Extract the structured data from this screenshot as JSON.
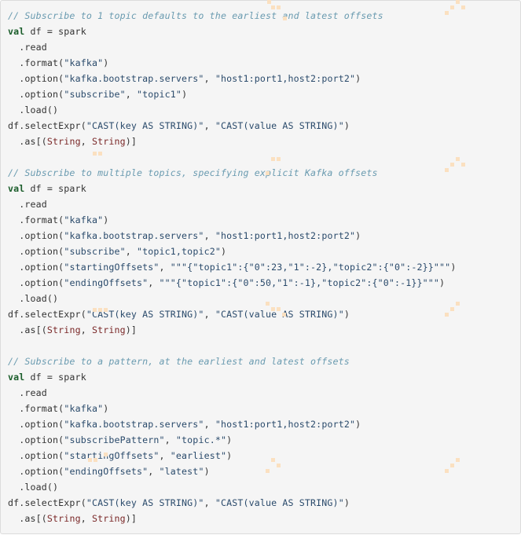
{
  "code_block": {
    "language": "scala",
    "lines": [
      [
        {
          "t": "comment",
          "v": "// Subscribe to 1 topic defaults to the earliest and latest offsets"
        }
      ],
      [
        {
          "t": "kw",
          "v": "val"
        },
        {
          "t": "plain",
          "v": " df = spark"
        }
      ],
      [
        {
          "t": "plain",
          "v": "  .read"
        }
      ],
      [
        {
          "t": "plain",
          "v": "  .format("
        },
        {
          "t": "str",
          "v": "\"kafka\""
        },
        {
          "t": "plain",
          "v": ")"
        }
      ],
      [
        {
          "t": "plain",
          "v": "  .option("
        },
        {
          "t": "str",
          "v": "\"kafka.bootstrap.servers\""
        },
        {
          "t": "plain",
          "v": ", "
        },
        {
          "t": "str",
          "v": "\"host1:port1,host2:port2\""
        },
        {
          "t": "plain",
          "v": ")"
        }
      ],
      [
        {
          "t": "plain",
          "v": "  .option("
        },
        {
          "t": "str",
          "v": "\"subscribe\""
        },
        {
          "t": "plain",
          "v": ", "
        },
        {
          "t": "str",
          "v": "\"topic1\""
        },
        {
          "t": "plain",
          "v": ")"
        }
      ],
      [
        {
          "t": "plain",
          "v": "  .load()"
        }
      ],
      [
        {
          "t": "plain",
          "v": "df.selectExpr("
        },
        {
          "t": "str",
          "v": "\"CAST(key AS STRING)\""
        },
        {
          "t": "plain",
          "v": ", "
        },
        {
          "t": "str",
          "v": "\"CAST(value AS STRING)\""
        },
        {
          "t": "plain",
          "v": ")"
        }
      ],
      [
        {
          "t": "plain",
          "v": "  .as[("
        },
        {
          "t": "type",
          "v": "String"
        },
        {
          "t": "plain",
          "v": ", "
        },
        {
          "t": "type",
          "v": "String"
        },
        {
          "t": "plain",
          "v": ")]"
        }
      ],
      [],
      [
        {
          "t": "comment",
          "v": "// Subscribe to multiple topics, specifying explicit Kafka offsets"
        }
      ],
      [
        {
          "t": "kw",
          "v": "val"
        },
        {
          "t": "plain",
          "v": " df = spark"
        }
      ],
      [
        {
          "t": "plain",
          "v": "  .read"
        }
      ],
      [
        {
          "t": "plain",
          "v": "  .format("
        },
        {
          "t": "str",
          "v": "\"kafka\""
        },
        {
          "t": "plain",
          "v": ")"
        }
      ],
      [
        {
          "t": "plain",
          "v": "  .option("
        },
        {
          "t": "str",
          "v": "\"kafka.bootstrap.servers\""
        },
        {
          "t": "plain",
          "v": ", "
        },
        {
          "t": "str",
          "v": "\"host1:port1,host2:port2\""
        },
        {
          "t": "plain",
          "v": ")"
        }
      ],
      [
        {
          "t": "plain",
          "v": "  .option("
        },
        {
          "t": "str",
          "v": "\"subscribe\""
        },
        {
          "t": "plain",
          "v": ", "
        },
        {
          "t": "str",
          "v": "\"topic1,topic2\""
        },
        {
          "t": "plain",
          "v": ")"
        }
      ],
      [
        {
          "t": "plain",
          "v": "  .option("
        },
        {
          "t": "str",
          "v": "\"startingOffsets\""
        },
        {
          "t": "plain",
          "v": ", "
        },
        {
          "t": "str",
          "v": "\"\"\"{\"topic1\":{\"0\":23,\"1\":-2},\"topic2\":{\"0\":-2}}\"\"\""
        },
        {
          "t": "plain",
          "v": ")"
        }
      ],
      [
        {
          "t": "plain",
          "v": "  .option("
        },
        {
          "t": "str",
          "v": "\"endingOffsets\""
        },
        {
          "t": "plain",
          "v": ", "
        },
        {
          "t": "str",
          "v": "\"\"\"{\"topic1\":{\"0\":50,\"1\":-1},\"topic2\":{\"0\":-1}}\"\"\""
        },
        {
          "t": "plain",
          "v": ")"
        }
      ],
      [
        {
          "t": "plain",
          "v": "  .load()"
        }
      ],
      [
        {
          "t": "plain",
          "v": "df.selectExpr("
        },
        {
          "t": "str",
          "v": "\"CAST(key AS STRING)\""
        },
        {
          "t": "plain",
          "v": ", "
        },
        {
          "t": "str",
          "v": "\"CAST(value AS STRING)\""
        },
        {
          "t": "plain",
          "v": ")"
        }
      ],
      [
        {
          "t": "plain",
          "v": "  .as[("
        },
        {
          "t": "type",
          "v": "String"
        },
        {
          "t": "plain",
          "v": ", "
        },
        {
          "t": "type",
          "v": "String"
        },
        {
          "t": "plain",
          "v": ")]"
        }
      ],
      [],
      [
        {
          "t": "comment",
          "v": "// Subscribe to a pattern, at the earliest and latest offsets"
        }
      ],
      [
        {
          "t": "kw",
          "v": "val"
        },
        {
          "t": "plain",
          "v": " df = spark"
        }
      ],
      [
        {
          "t": "plain",
          "v": "  .read"
        }
      ],
      [
        {
          "t": "plain",
          "v": "  .format("
        },
        {
          "t": "str",
          "v": "\"kafka\""
        },
        {
          "t": "plain",
          "v": ")"
        }
      ],
      [
        {
          "t": "plain",
          "v": "  .option("
        },
        {
          "t": "str",
          "v": "\"kafka.bootstrap.servers\""
        },
        {
          "t": "plain",
          "v": ", "
        },
        {
          "t": "str",
          "v": "\"host1:port1,host2:port2\""
        },
        {
          "t": "plain",
          "v": ")"
        }
      ],
      [
        {
          "t": "plain",
          "v": "  .option("
        },
        {
          "t": "str",
          "v": "\"subscribePattern\""
        },
        {
          "t": "plain",
          "v": ", "
        },
        {
          "t": "str",
          "v": "\"topic.*\""
        },
        {
          "t": "plain",
          "v": ")"
        }
      ],
      [
        {
          "t": "plain",
          "v": "  .option("
        },
        {
          "t": "str",
          "v": "\"startingOffsets\""
        },
        {
          "t": "plain",
          "v": ", "
        },
        {
          "t": "str",
          "v": "\"earliest\""
        },
        {
          "t": "plain",
          "v": ")"
        }
      ],
      [
        {
          "t": "plain",
          "v": "  .option("
        },
        {
          "t": "str",
          "v": "\"endingOffsets\""
        },
        {
          "t": "plain",
          "v": ", "
        },
        {
          "t": "str",
          "v": "\"latest\""
        },
        {
          "t": "plain",
          "v": ")"
        }
      ],
      [
        {
          "t": "plain",
          "v": "  .load()"
        }
      ],
      [
        {
          "t": "plain",
          "v": "df.selectExpr("
        },
        {
          "t": "str",
          "v": "\"CAST(key AS STRING)\""
        },
        {
          "t": "plain",
          "v": ", "
        },
        {
          "t": "str",
          "v": "\"CAST(value AS STRING)\""
        },
        {
          "t": "plain",
          "v": ")"
        }
      ],
      [
        {
          "t": "plain",
          "v": "  .as[("
        },
        {
          "t": "type",
          "v": "String"
        },
        {
          "t": "plain",
          "v": ", "
        },
        {
          "t": "type",
          "v": "String"
        },
        {
          "t": "plain",
          "v": ")]"
        }
      ]
    ]
  },
  "colors": {
    "background": "#f5f5f5",
    "comment": "#6a9bb0",
    "keyword": "#1a5d2a",
    "string": "#2a4a6b",
    "type": "#7a2828",
    "plain": "#333333"
  }
}
